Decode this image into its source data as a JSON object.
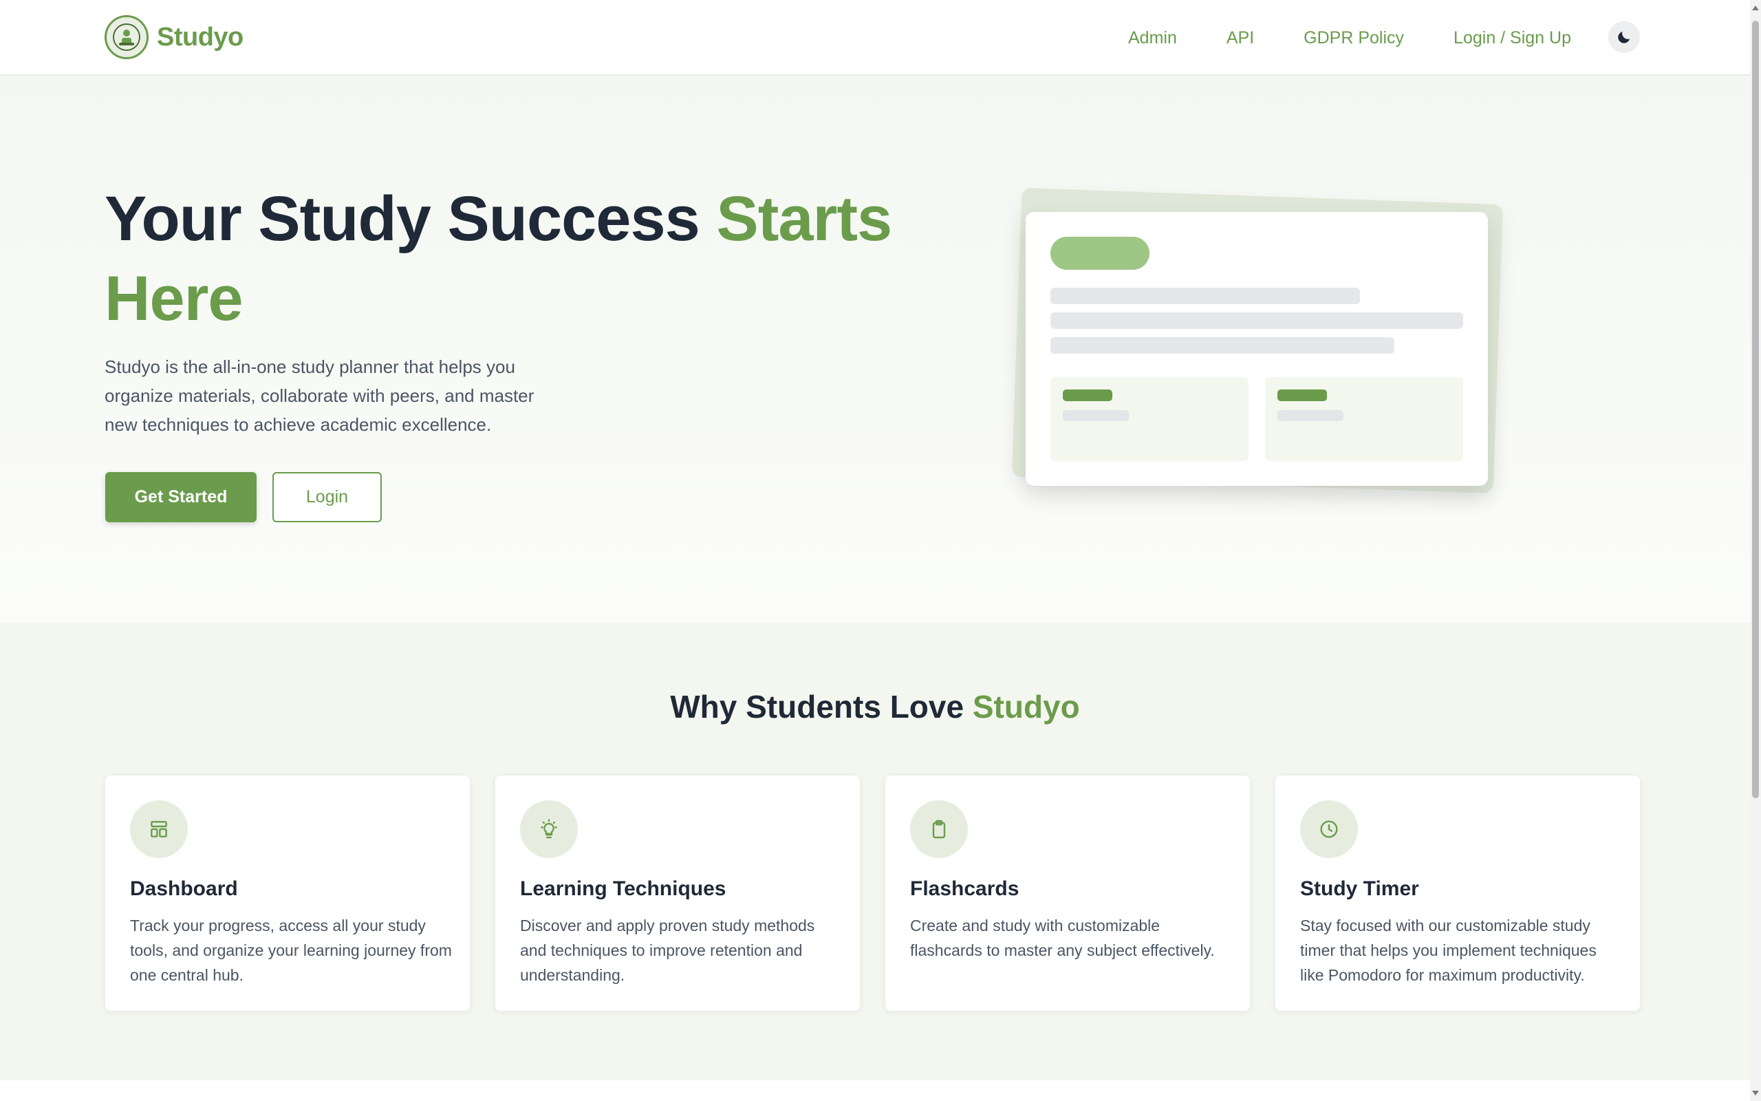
{
  "brand": {
    "name": "Studyo"
  },
  "nav": {
    "links": [
      "Admin",
      "API",
      "GDPR Policy",
      "Login / Sign Up"
    ],
    "theme_toggle_icon": "moon-icon"
  },
  "hero": {
    "title_part1": "Your Study Success ",
    "title_accent": "Starts Here",
    "description": "Studyo is the all-in-one study planner that helps you organize materials, collaborate with peers, and master new techniques to achieve academic excellence.",
    "primary_button": "Get Started",
    "secondary_button": "Login"
  },
  "features": {
    "title_part1": "Why Students Love ",
    "title_accent": "Studyo",
    "cards": [
      {
        "icon": "dashboard-icon",
        "title": "Dashboard",
        "text": "Track your progress, access all your study tools, and organize your learning journey from one central hub."
      },
      {
        "icon": "lightbulb-icon",
        "title": "Learning Techniques",
        "text": "Discover and apply proven study methods and techniques to improve retention and understanding."
      },
      {
        "icon": "clipboard-icon",
        "title": "Flashcards",
        "text": "Create and study with customizable flashcards to master any subject effectively."
      },
      {
        "icon": "clock-icon",
        "title": "Study Timer",
        "text": "Stay focused with our customizable study timer that helps you implement techniques like Pomodoro for maximum productivity."
      }
    ]
  },
  "colors": {
    "accent": "#6a9c4c",
    "accent_light": "#9ec684",
    "text_dark": "#1f2937"
  }
}
